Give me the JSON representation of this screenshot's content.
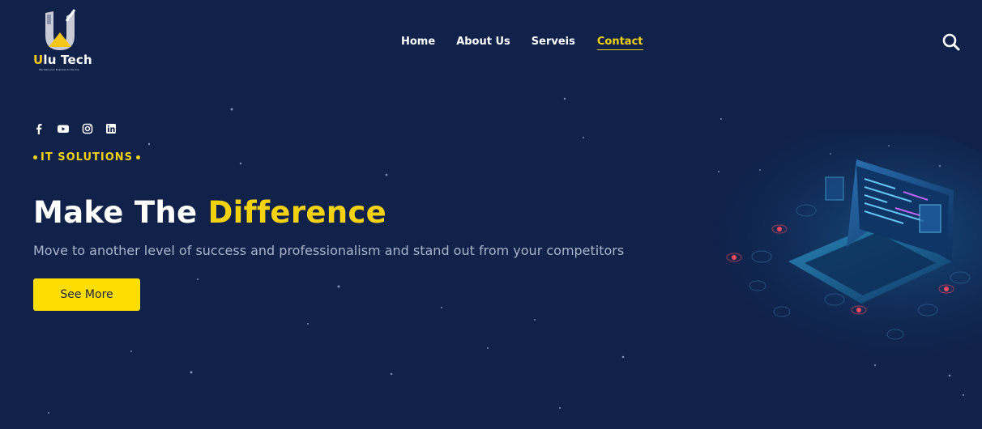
{
  "brand": {
    "name_first_letter": "U",
    "name_rest": "lu Tech",
    "tagline": "We take your Business to the top"
  },
  "nav": {
    "items": [
      {
        "label": "Home"
      },
      {
        "label": "About Us"
      },
      {
        "label": "Serveis"
      },
      {
        "label": "Contact"
      }
    ],
    "active_index": 3
  },
  "social": [
    "facebook-icon",
    "youtube-icon",
    "instagram-icon",
    "linkedin-icon"
  ],
  "hero": {
    "eyebrow": "IT SOLUTIONS",
    "headline_plain": "Make The ",
    "headline_highlight": "Difference",
    "subtitle": "Move to another level of success and professionalism and stand out from your competitors",
    "cta_label": "See More"
  },
  "colors": {
    "background": "#10224a",
    "accent": "#f5d20f",
    "button": "#fedd00",
    "subtitle": "#a9b4cc"
  }
}
